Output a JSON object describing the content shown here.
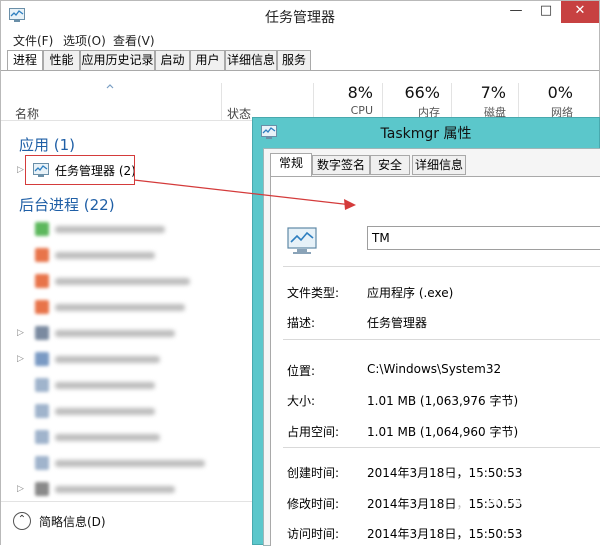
{
  "taskmgr": {
    "title": "任务管理器",
    "window_controls": {
      "minimize": "—",
      "maximize": "□",
      "close": "✕"
    },
    "menu": [
      "文件(F)",
      "选项(O)",
      "查看(V)"
    ],
    "tabs": [
      "进程",
      "性能",
      "应用历史记录",
      "启动",
      "用户",
      "详细信息",
      "服务"
    ],
    "active_tab": "进程",
    "columns": {
      "name": "名称",
      "status": "状态"
    },
    "metrics": [
      {
        "pct": "8%",
        "label": "CPU"
      },
      {
        "pct": "66%",
        "label": "内存"
      },
      {
        "pct": "7%",
        "label": "磁盘"
      },
      {
        "pct": "0%",
        "label": "网络"
      }
    ],
    "groups": {
      "apps": "应用 (1)",
      "background": "后台进程 (22)"
    },
    "app_process": "任务管理器 (2)",
    "footer": "简略信息(D)"
  },
  "props": {
    "title": "Taskmgr 属性",
    "tabs": [
      "常规",
      "数字签名",
      "安全",
      "详细信息"
    ],
    "active_tab": "常规",
    "name_value": "TM",
    "rows": {
      "file_type": {
        "label": "文件类型:",
        "value": "应用程序 (.exe)"
      },
      "description": {
        "label": "描述:",
        "value": "任务管理器"
      },
      "location": {
        "label": "位置:",
        "value": "C:\\Windows\\System32"
      },
      "size": {
        "label": "大小:",
        "value": "1.01 MB (1,063,976 字节)"
      },
      "size_on_disk": {
        "label": "占用空间:",
        "value": "1.01 MB (1,064,960 字节)"
      },
      "created": {
        "label": "创建时间:",
        "value": "2014年3月18日，15:50:53"
      },
      "modified": {
        "label": "修改时间:",
        "value": "2014年3月18日，15:50:53"
      },
      "accessed": {
        "label": "访问时间:",
        "value": "2014年3月18日，15:50:53"
      }
    }
  },
  "colors": {
    "accent_blue": "#1f5fa6",
    "dialog_frame": "#5bc7cb",
    "close_red": "#c74141",
    "annotation_red": "#d43b3b"
  },
  "watermark": {
    "text": "系统城",
    "sub": "XITONGCHENG.COM"
  }
}
